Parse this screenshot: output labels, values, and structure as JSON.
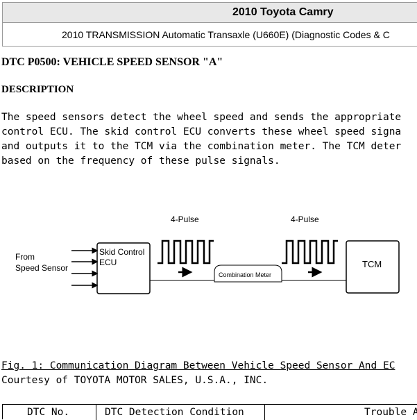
{
  "header": {
    "vehicle": "2010 Toyota Camry",
    "subtitle": "2010 TRANSMISSION Automatic Transaxle (U660E) (Diagnostic Codes & C"
  },
  "doc": {
    "title": "DTC P0500: VEHICLE SPEED SENSOR \"A\"",
    "section": "DESCRIPTION",
    "paragraph": [
      "The speed sensors detect the wheel speed and sends the appropriate",
      "control ECU. The skid control ECU converts these wheel speed signa",
      "and outputs it to the TCM via the combination meter. The TCM deter",
      "based on the frequency of these pulse signals."
    ]
  },
  "diagram": {
    "from_label": [
      "From",
      "Speed Sensor"
    ],
    "skid_label": [
      "Skid Control",
      "ECU"
    ],
    "pulse_label_1": "4-Pulse",
    "pulse_label_2": "4-Pulse",
    "meter_label": "Combination Meter",
    "tcm_label": "TCM"
  },
  "figure": {
    "caption": "Fig. 1: Communication Diagram Between Vehicle Speed Sensor And EC",
    "courtesy": "Courtesy of TOYOTA MOTOR SALES, U.S.A., INC."
  },
  "table": {
    "headers": [
      "DTC No.",
      "DTC Detection Condition",
      "Trouble A"
    ]
  }
}
